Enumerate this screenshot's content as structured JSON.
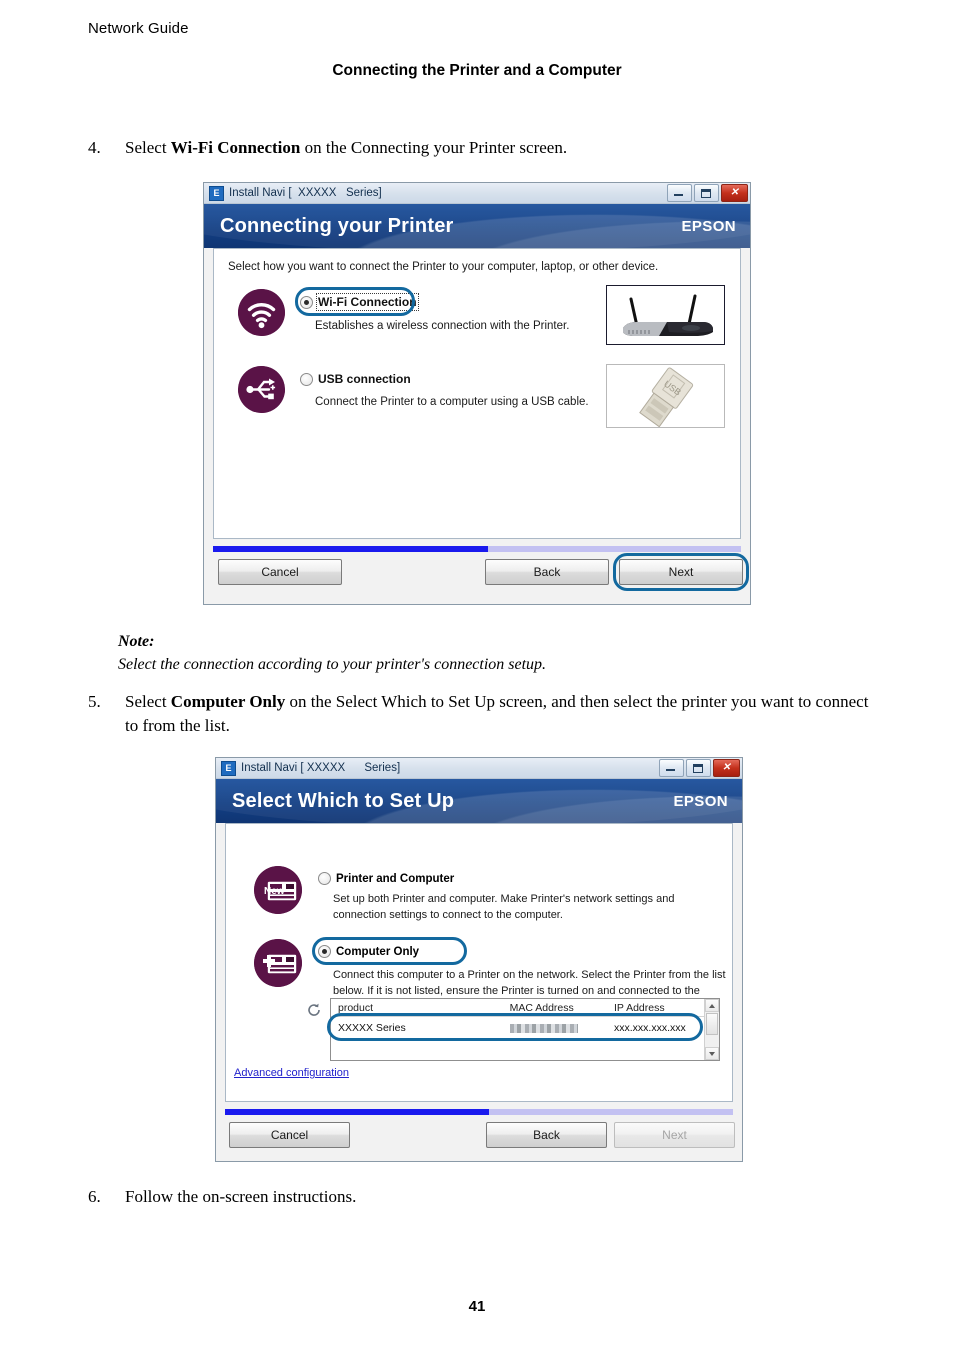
{
  "page": {
    "running_head": "Network Guide",
    "chapter_title": "Connecting the Printer and a Computer",
    "page_number": "41"
  },
  "steps": {
    "step4": {
      "number": "4.",
      "text_before": "Select ",
      "bold": "Wi-Fi Connection",
      "text_after": " on the Connecting your Printer screen."
    },
    "step5": {
      "number": "5.",
      "text_before": "Select ",
      "bold": "Computer Only",
      "text_after": " on the Select Which to Set Up screen, and then select the printer you want to connect to from the list."
    },
    "step6": {
      "number": "6.",
      "text": "Follow the on-screen instructions."
    }
  },
  "note": {
    "label": "Note:",
    "text": "Select the connection according to your printer's connection setup."
  },
  "dialog1": {
    "titlebar": {
      "icon": "install-navi-icon",
      "title": "Install Navi [  XXXXX   Series]",
      "minimize": "minimize-icon",
      "maximize": "maximize-icon",
      "close": "close-icon"
    },
    "banner": {
      "title": "Connecting your Printer",
      "brand": "EPSON"
    },
    "intro": "Select how you want to connect the Printer to your computer, laptop, or other device.",
    "options": [
      {
        "icon": "wifi-icon",
        "label": "Wi-Fi Connection",
        "selected": true,
        "description": "Establishes a wireless connection with the Printer.",
        "thumbnail": "wireless-router-image"
      },
      {
        "icon": "usb-icon",
        "label": "USB connection",
        "selected": false,
        "description": "Connect the Printer to a computer using a USB cable.",
        "thumbnail": "usb-connector-image"
      }
    ],
    "progress_percent": 52,
    "buttons": {
      "cancel": "Cancel",
      "back": "Back",
      "next": "Next",
      "next_disabled": false,
      "next_highlighted": true
    },
    "highlight_option": "Wi-Fi Connection"
  },
  "dialog2": {
    "titlebar": {
      "icon": "install-navi-icon",
      "title": "Install Navi [ XXXXX      Series]",
      "minimize": "minimize-icon",
      "maximize": "maximize-icon",
      "close": "close-icon"
    },
    "banner": {
      "title": "Select Which to Set Up",
      "brand": "EPSON"
    },
    "options": [
      {
        "icon": "new-printer-icon",
        "badge": "New",
        "label": "Printer and Computer",
        "selected": false,
        "description": "Set up both Printer and computer. Make Printer's network settings and connection settings to connect to the computer."
      },
      {
        "icon": "add-printer-icon",
        "badge": "+",
        "label": "Computer Only",
        "selected": true,
        "description": "Connect this computer to a Printer on the network. Select the Printer from the list below. If it is not listed, ensure the Printer is turned on and connected to the network."
      }
    ],
    "refresh_icon": "refresh-icon",
    "printer_list": {
      "columns": [
        "product",
        "MAC Address",
        "IP Address"
      ],
      "rows": [
        {
          "product": "XXXXX  Series",
          "mac": "",
          "ip": "xxx.xxx.xxx.xxx"
        }
      ]
    },
    "advanced_link": "Advanced configuration",
    "progress_percent": 52,
    "buttons": {
      "cancel": "Cancel",
      "back": "Back",
      "next": "Next",
      "next_disabled": true,
      "next_highlighted": false
    },
    "highlight_option": "Computer Only",
    "highlight_row": "XXXXX  Series"
  },
  "colors": {
    "banner_blue": "#133f84",
    "highlight_ring": "#13699f",
    "icon_plum": "#5a1347",
    "progress_fill": "#1a1aee",
    "progress_track": "#c3c1f2",
    "link_blue": "#2222cc"
  }
}
